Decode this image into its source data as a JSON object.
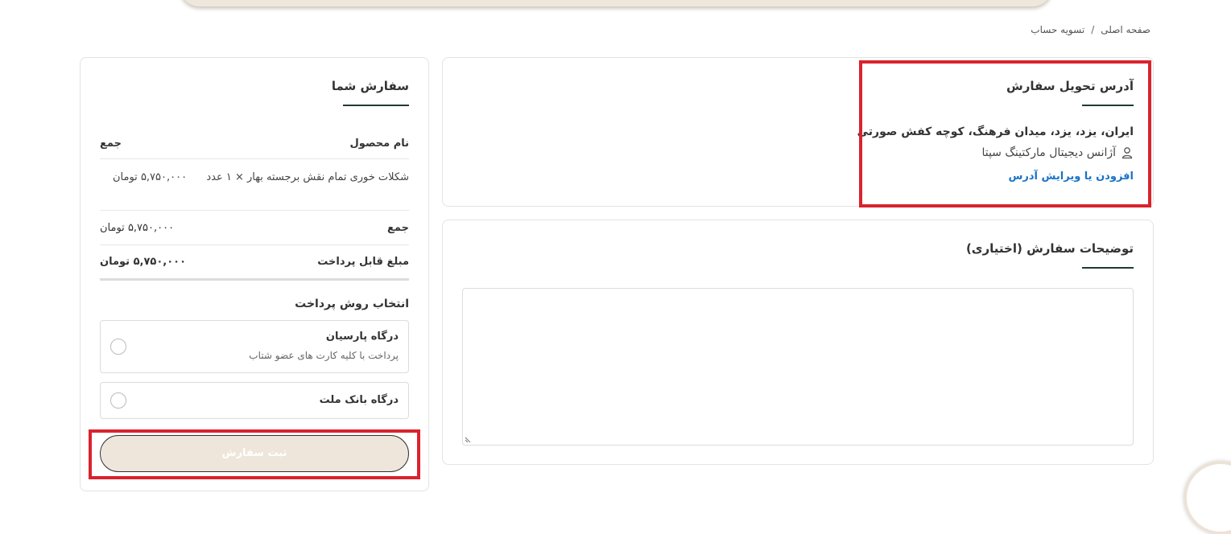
{
  "breadcrumb": {
    "home": "صفحه اصلی",
    "separator": "/",
    "current": "تسویه حساب"
  },
  "address": {
    "title": "آدرس تحویل سفارش",
    "line1": "ایران، یزد، یزد، میدان فرهنگ، کوچه کفش صورتی",
    "name": "آژانس دیجیتال مارکتینگ سپتا",
    "edit_link": "افزودن یا ویرایش آدرس",
    "icon": "person-icon"
  },
  "notes": {
    "title": "توضیحات سفارش (اختیاری)",
    "value": ""
  },
  "order": {
    "title": "سفارش شما",
    "headers": {
      "product": "نام محصول",
      "total": "جمع"
    },
    "items": [
      {
        "name": "شکلات خوری تمام نقش برجسته بهار × ۱ عدد",
        "total": "۵,۷۵۰,۰۰۰ تومان"
      }
    ],
    "subtotal_label": "جمع",
    "subtotal_value": "۵,۷۵۰,۰۰۰ تومان",
    "payable_label": "مبلغ قابل پرداخت",
    "payable_value": "۵,۷۵۰,۰۰۰ تومان"
  },
  "payment": {
    "title": "انتخاب روش پرداخت",
    "options": [
      {
        "title": "درگاه پارسیان",
        "desc": "پرداخت با کلیه کارت های عضو شتاب"
      },
      {
        "title": "درگاه بانک ملت",
        "desc": ""
      }
    ]
  },
  "submit": {
    "label": "ثبت سفارش"
  },
  "colors": {
    "accent_dark": "#1f3a33",
    "link": "#1a73c5",
    "highlight": "#d9232d",
    "beige": "#efe6db"
  }
}
